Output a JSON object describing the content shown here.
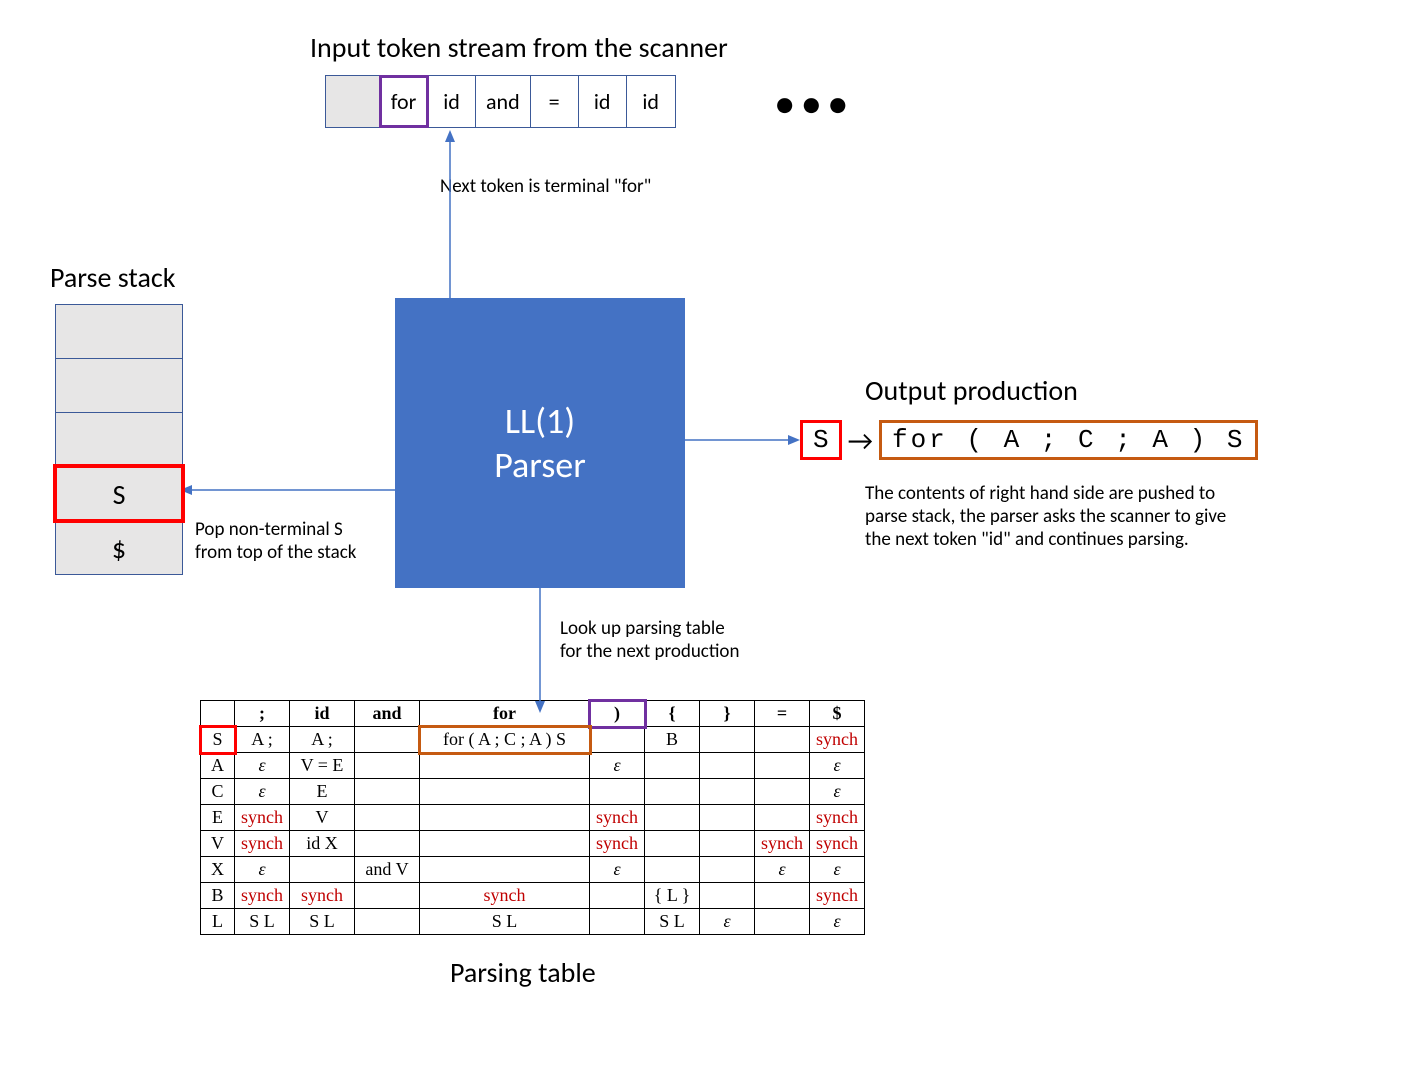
{
  "labels": {
    "title_top": "Input token stream from the scanner",
    "next_token": "Next token is terminal \"for\"",
    "parse_stack": "Parse stack",
    "pop": "Pop non-terminal S from top of the stack",
    "parser": "LL(1) Parser",
    "output_prod": "Output production",
    "output_desc": "The contents of right hand side are pushed to parse stack, the parser asks the scanner to give the next token \"id\" and continues parsing.",
    "lookup": "Look up parsing table for the next production",
    "parsing_table": "Parsing table",
    "ellipsis": "● ● ●"
  },
  "token_stream": {
    "cells": [
      {
        "text": "",
        "shaded": true,
        "highlight": false
      },
      {
        "text": "for",
        "shaded": false,
        "highlight": true
      },
      {
        "text": "id",
        "shaded": false,
        "highlight": false
      },
      {
        "text": "and",
        "shaded": false,
        "highlight": false
      },
      {
        "text": "=",
        "shaded": false,
        "highlight": false
      },
      {
        "text": "id",
        "shaded": false,
        "highlight": false
      },
      {
        "text": "id",
        "shaded": false,
        "highlight": false
      }
    ]
  },
  "stack": {
    "cells": [
      {
        "text": "",
        "highlight": false
      },
      {
        "text": "",
        "highlight": false
      },
      {
        "text": "",
        "highlight": false
      },
      {
        "text": "S",
        "highlight": true
      },
      {
        "text": "$",
        "highlight": false
      }
    ]
  },
  "production": {
    "lhs": "S",
    "arrow": "→",
    "rhs": "for ( A ; C ; A ) S"
  },
  "parsing_table": {
    "headers": [
      "",
      ";",
      "id",
      "and",
      "for",
      ")",
      "{",
      "}",
      "=",
      "$"
    ],
    "rows": [
      {
        "label": "S",
        "cells": [
          "A ;",
          "A ;",
          "",
          "for ( A ; C ; A ) S",
          "",
          "B",
          "",
          "",
          "synch"
        ]
      },
      {
        "label": "A",
        "cells": [
          "ε",
          "V = E",
          "",
          "",
          "ε",
          "",
          "",
          "",
          "ε"
        ]
      },
      {
        "label": "C",
        "cells": [
          "ε",
          "E",
          "",
          "",
          "",
          "",
          "",
          "",
          "ε"
        ]
      },
      {
        "label": "E",
        "cells": [
          "synch",
          "V",
          "",
          "",
          "synch",
          "",
          "",
          "",
          "synch"
        ]
      },
      {
        "label": "V",
        "cells": [
          "synch",
          "id X",
          "",
          "",
          "synch",
          "",
          "",
          "synch",
          "synch"
        ]
      },
      {
        "label": "X",
        "cells": [
          "ε",
          "",
          "and V",
          "",
          "ε",
          "",
          "",
          "ε",
          "ε"
        ]
      },
      {
        "label": "B",
        "cells": [
          "synch",
          "synch",
          "",
          "synch",
          "",
          "{ L }",
          "",
          "",
          "synch"
        ]
      },
      {
        "label": "L",
        "cells": [
          "S L",
          "S L",
          "",
          "S L",
          "",
          "S L",
          "ε",
          "",
          "ε"
        ]
      }
    ],
    "highlight_header_col": 4,
    "highlight_row": 0,
    "highlight_cell_row": 0,
    "highlight_cell_col": 4
  }
}
